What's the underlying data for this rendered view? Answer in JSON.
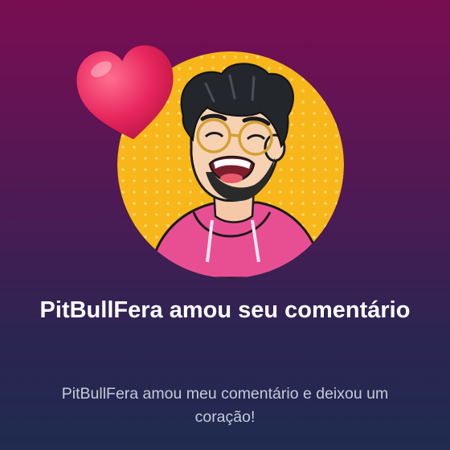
{
  "notification": {
    "title": "PitBullFera amou seu comentário",
    "message": "PitBullFera amou meu comentário e deixou um coração!",
    "avatar_icon": "user-avatar-illustration",
    "reaction_icon": "heart-icon"
  },
  "colors": {
    "avatar_bg": "#f7b61a",
    "heart": "#e8265e",
    "hoodie": "#e84f93"
  }
}
